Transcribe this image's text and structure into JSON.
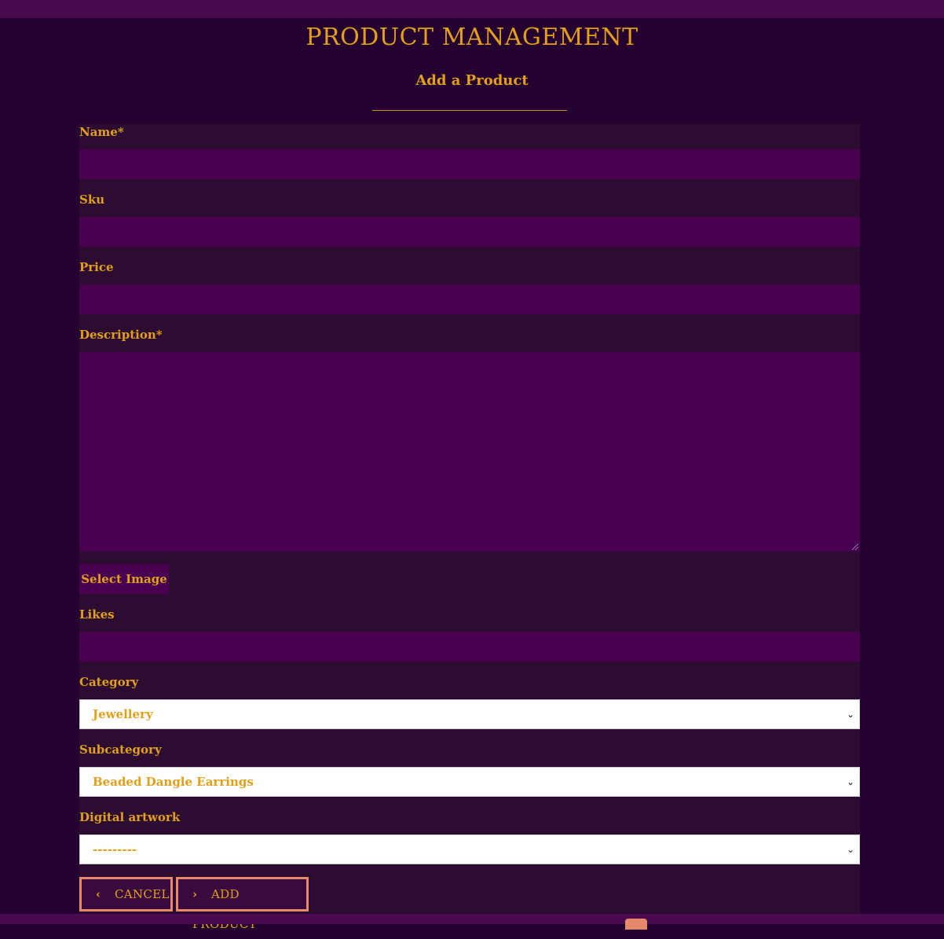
{
  "header": {
    "title": "PRODUCT MANAGEMENT",
    "subtitle": "Add a Product"
  },
  "form": {
    "name_label": "Name*",
    "name_value": "",
    "sku_label": "Sku",
    "sku_value": "",
    "price_label": "Price",
    "price_value": "",
    "description_label": "Description*",
    "description_value": "",
    "select_image_label": "Select Image",
    "likes_label": "Likes",
    "likes_value": "",
    "category_label": "Category",
    "category_selected": "Jewellery",
    "subcategory_label": "Subcategory",
    "subcategory_selected": "Beaded Dangle Earrings",
    "digital_artwork_label": "Digital artwork",
    "digital_artwork_selected": "---------"
  },
  "actions": {
    "cancel_label": "CANCEL",
    "add_label": "ADD PRODUCT"
  },
  "colors": {
    "background": "#240130",
    "panel": "#2c0c30",
    "input": "#4a0050",
    "accent_text": "#e2a01a",
    "button_border": "#e48a6a"
  },
  "icons": {
    "cancel": "chevron-left-icon",
    "add": "chevron-right-icon",
    "select": "chevron-down-icon"
  }
}
